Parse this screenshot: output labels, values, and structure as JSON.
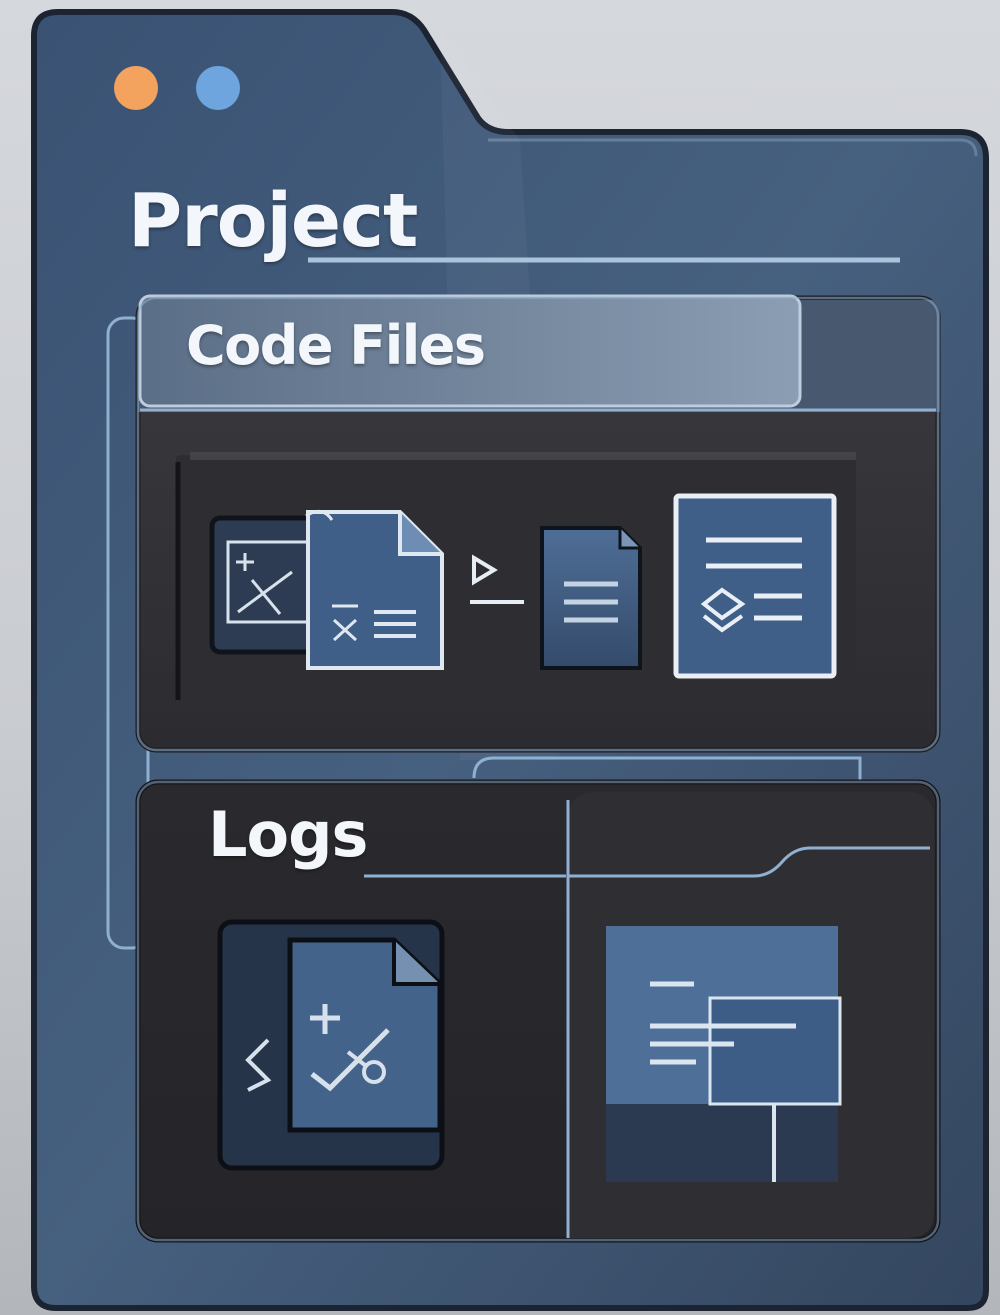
{
  "window": {
    "title": "Project",
    "controls": [
      "orange-dot",
      "blue-dot"
    ]
  },
  "sections": {
    "code_files": {
      "label": "Code Files",
      "icons": [
        "code-graph-icon",
        "code-file-icon",
        "terminal-prompt-icon",
        "text-document-icon",
        "layered-document-icon"
      ]
    },
    "logs": {
      "label": "Logs",
      "icons": [
        "log-file-icon",
        "log-window-icon"
      ]
    }
  },
  "colors": {
    "window": "#3e5878",
    "panel": "#2f2f33",
    "header_bar": "#6d8299",
    "accent_blue": "#4a6d98",
    "line": "#9fbad6",
    "dot_orange": "#f4a35f",
    "dot_blue": "#6fa5de"
  }
}
